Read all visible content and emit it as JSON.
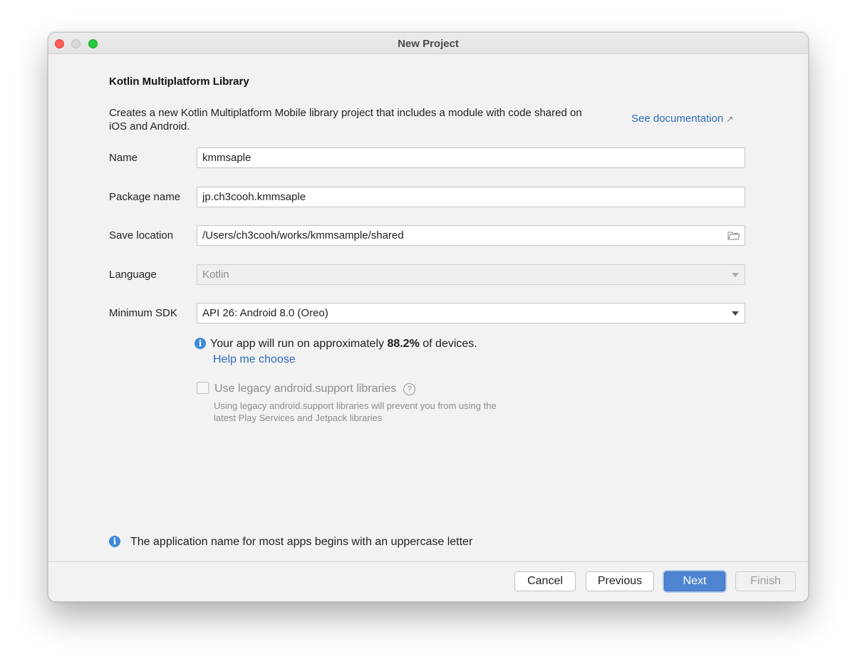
{
  "window": {
    "title": "New Project"
  },
  "template": {
    "heading": "Kotlin Multiplatform Library",
    "description": "Creates a new Kotlin Multiplatform Mobile library project that includes a module with code shared on iOS and Android.",
    "documentation_link": "See documentation"
  },
  "form": {
    "name_label": "Name",
    "name_value": "kmmsaple",
    "package_label": "Package name",
    "package_value": "jp.ch3cooh.kmmsaple",
    "location_label": "Save location",
    "location_value": "/Users/ch3cooh/works/kmmsample/shared",
    "language_label": "Language",
    "language_value": "Kotlin",
    "min_sdk_label": "Minimum SDK",
    "min_sdk_value": "API 26: Android 8.0 (Oreo)"
  },
  "sdk_info": {
    "prefix": "Your app will run on approximately ",
    "percentage": "88.2%",
    "suffix": " of devices.",
    "help_link": "Help me choose"
  },
  "legacy": {
    "checkbox_label": "Use legacy android.support libraries",
    "checked": false,
    "hint": "Using legacy android.support libraries will prevent you from using the latest Play Services and Jetpack libraries"
  },
  "validation": {
    "message": "The application name for most apps begins with an uppercase letter"
  },
  "buttons": {
    "cancel": "Cancel",
    "previous": "Previous",
    "next": "Next",
    "finish": "Finish"
  },
  "colors": {
    "accent": "#4f85d0",
    "link": "#2f6db8",
    "info": "#3d8ad8",
    "close": "#fe5f57",
    "maximize": "#28c840"
  }
}
